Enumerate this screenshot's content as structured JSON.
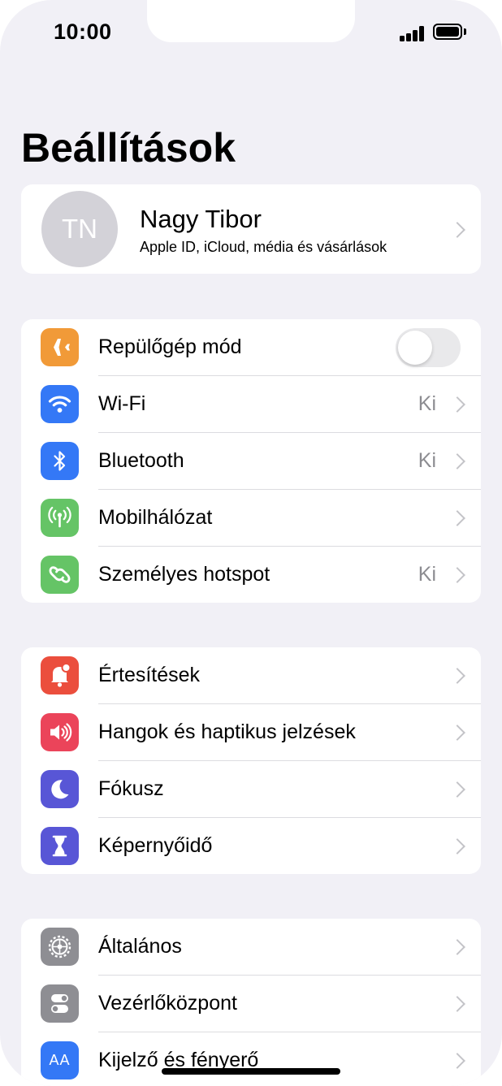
{
  "status_bar": {
    "time": "10:00",
    "signal_icon": "cellular-signal-icon",
    "battery_icon": "battery-icon"
  },
  "page_title": "Beállítások",
  "profile": {
    "initials": "TN",
    "name": "Nagy Tibor",
    "subtitle": "Apple ID, iCloud, média és vásárlások"
  },
  "groups": [
    {
      "items": [
        {
          "label": "Repülőgép mód",
          "icon": "airplane-icon",
          "icon_color": "#f19a38",
          "control": "toggle",
          "toggle_on": false
        },
        {
          "label": "Wi-Fi",
          "icon": "wifi-icon",
          "icon_color": "#3478f6",
          "value": "Ki"
        },
        {
          "label": "Bluetooth",
          "icon": "bluetooth-icon",
          "icon_color": "#3478f6",
          "value": "Ki"
        },
        {
          "label": "Mobilhálózat",
          "icon": "antenna-icon",
          "icon_color": "#65c466",
          "value": ""
        },
        {
          "label": "Személyes hotspot",
          "icon": "hotspot-link-icon",
          "icon_color": "#65c466",
          "value": "Ki"
        }
      ]
    },
    {
      "items": [
        {
          "label": "Értesítések",
          "icon": "bell-icon",
          "icon_color": "#eb4e3d"
        },
        {
          "label": "Hangok és haptikus jelzések",
          "icon": "speaker-icon",
          "icon_color": "#eb445a"
        },
        {
          "label": "Fókusz",
          "icon": "moon-icon",
          "icon_color": "#5856d6"
        },
        {
          "label": "Képernyőidő",
          "icon": "hourglass-icon",
          "icon_color": "#5856d6"
        }
      ]
    },
    {
      "items": [
        {
          "label": "Általános",
          "icon": "gear-icon",
          "icon_color": "#8e8e93"
        },
        {
          "label": "Vezérlőközpont",
          "icon": "switches-icon",
          "icon_color": "#8e8e93"
        },
        {
          "label": "Kijelző és fényerő",
          "icon": "text-size-icon",
          "icon_color": "#3478f6",
          "icon_text": "AA"
        }
      ]
    }
  ]
}
